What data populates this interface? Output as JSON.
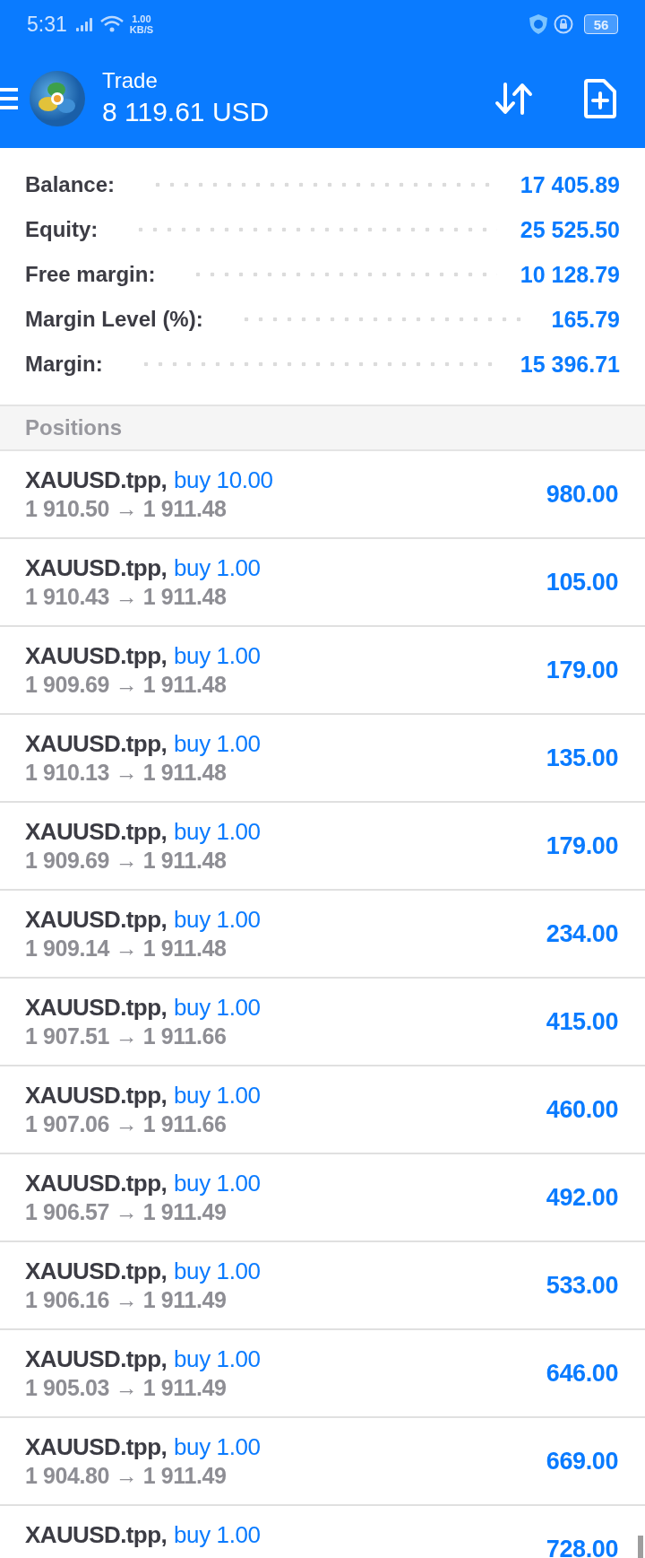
{
  "status_bar": {
    "time": "5:31",
    "net_speed": "1.00",
    "net_unit": "KB/S",
    "battery": "56"
  },
  "header": {
    "title": "Trade",
    "balance": "8 119.61 USD"
  },
  "summary": [
    {
      "label": "Balance:",
      "value": "17 405.89"
    },
    {
      "label": "Equity:",
      "value": "25 525.50"
    },
    {
      "label": "Free margin:",
      "value": "10 128.79"
    },
    {
      "label": "Margin Level (%):",
      "value": "165.79"
    },
    {
      "label": "Margin:",
      "value": "15 396.71"
    }
  ],
  "section_title": "Positions",
  "positions": [
    {
      "symbol": "XAUUSD.tpp,",
      "order": "buy 10.00",
      "prices": "1 910.50 → 1 911.48",
      "profit": "980.00"
    },
    {
      "symbol": "XAUUSD.tpp,",
      "order": "buy 1.00",
      "prices": "1 910.43 → 1 911.48",
      "profit": "105.00"
    },
    {
      "symbol": "XAUUSD.tpp,",
      "order": "buy 1.00",
      "prices": "1 909.69 → 1 911.48",
      "profit": "179.00"
    },
    {
      "symbol": "XAUUSD.tpp,",
      "order": "buy 1.00",
      "prices": "1 910.13 → 1 911.48",
      "profit": "135.00"
    },
    {
      "symbol": "XAUUSD.tpp,",
      "order": "buy 1.00",
      "prices": "1 909.69 → 1 911.48",
      "profit": "179.00"
    },
    {
      "symbol": "XAUUSD.tpp,",
      "order": "buy 1.00",
      "prices": "1 909.14 → 1 911.48",
      "profit": "234.00"
    },
    {
      "symbol": "XAUUSD.tpp,",
      "order": "buy 1.00",
      "prices": "1 907.51 → 1 911.66",
      "profit": "415.00"
    },
    {
      "symbol": "XAUUSD.tpp,",
      "order": "buy 1.00",
      "prices": "1 907.06 → 1 911.66",
      "profit": "460.00"
    },
    {
      "symbol": "XAUUSD.tpp,",
      "order": "buy 1.00",
      "prices": "1 906.57 → 1 911.49",
      "profit": "492.00"
    },
    {
      "symbol": "XAUUSD.tpp,",
      "order": "buy 1.00",
      "prices": "1 906.16 → 1 911.49",
      "profit": "533.00"
    },
    {
      "symbol": "XAUUSD.tpp,",
      "order": "buy 1.00",
      "prices": "1 905.03 → 1 911.49",
      "profit": "646.00"
    },
    {
      "symbol": "XAUUSD.tpp,",
      "order": "buy 1.00",
      "prices": "1 904.80 → 1 911.49",
      "profit": "669.00"
    },
    {
      "symbol": "XAUUSD.tpp,",
      "order": "buy 1.00",
      "profit": "728.00"
    }
  ]
}
